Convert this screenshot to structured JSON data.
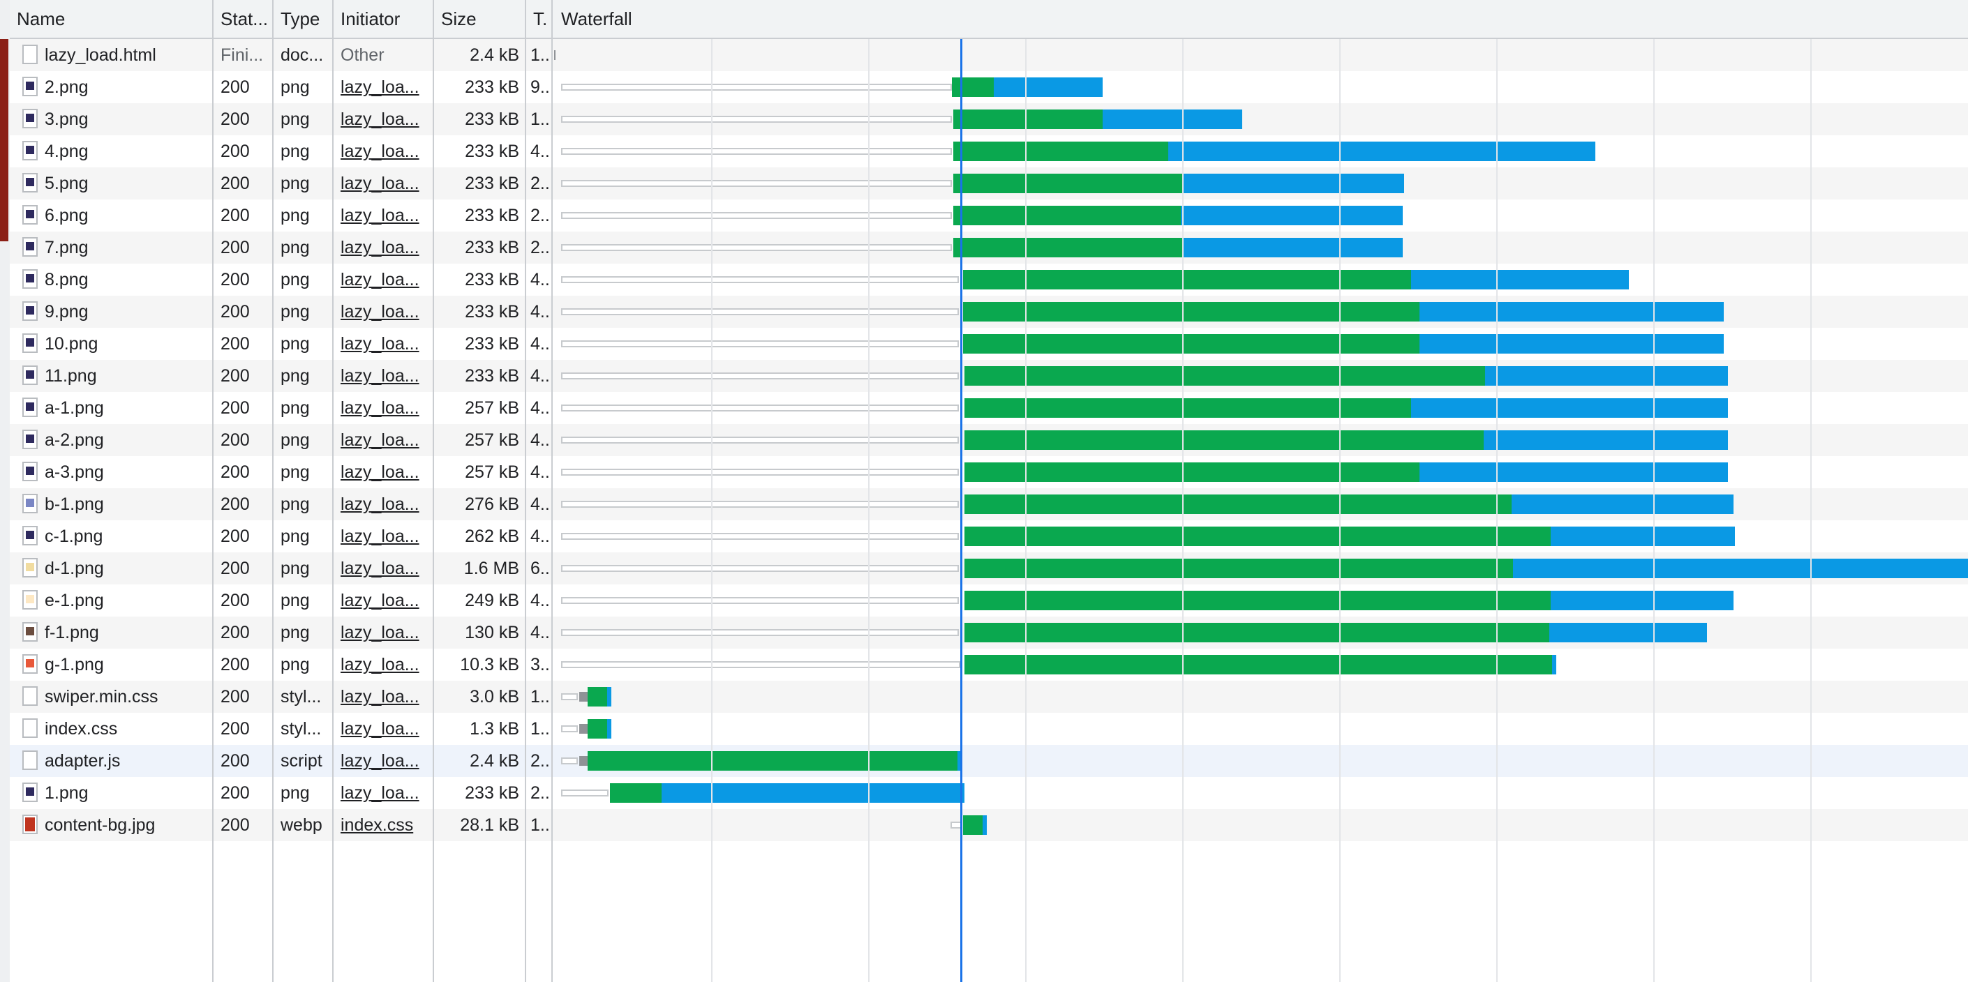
{
  "columns": {
    "name": "Name",
    "status": "Stat...",
    "type": "Type",
    "initiator": "Initiator",
    "size": "Size",
    "time": "T.",
    "waterfall": "Waterfall"
  },
  "colors": {
    "waiting_ttfb": "#0aa84f",
    "content_download": "#0a99e4",
    "dom_content_loaded_line": "#1a73e8",
    "header_bg": "#f1f3f4"
  },
  "rows": [
    {
      "name": "lazy_load.html",
      "status": "Fini...",
      "type": "doc...",
      "initiator": "Other",
      "size": "2.4 kB",
      "time": "1..",
      "icon": "document-icon"
    },
    {
      "name": "2.png",
      "status": "200",
      "type": "png",
      "initiator": "lazy_loa...",
      "size": "233 kB",
      "time": "9..",
      "icon": "image-icon"
    },
    {
      "name": "3.png",
      "status": "200",
      "type": "png",
      "initiator": "lazy_loa...",
      "size": "233 kB",
      "time": "1..",
      "icon": "image-icon"
    },
    {
      "name": "4.png",
      "status": "200",
      "type": "png",
      "initiator": "lazy_loa...",
      "size": "233 kB",
      "time": "4..",
      "icon": "image-icon"
    },
    {
      "name": "5.png",
      "status": "200",
      "type": "png",
      "initiator": "lazy_loa...",
      "size": "233 kB",
      "time": "2..",
      "icon": "image-icon"
    },
    {
      "name": "6.png",
      "status": "200",
      "type": "png",
      "initiator": "lazy_loa...",
      "size": "233 kB",
      "time": "2..",
      "icon": "image-icon"
    },
    {
      "name": "7.png",
      "status": "200",
      "type": "png",
      "initiator": "lazy_loa...",
      "size": "233 kB",
      "time": "2..",
      "icon": "image-icon"
    },
    {
      "name": "8.png",
      "status": "200",
      "type": "png",
      "initiator": "lazy_loa...",
      "size": "233 kB",
      "time": "4..",
      "icon": "image-icon"
    },
    {
      "name": "9.png",
      "status": "200",
      "type": "png",
      "initiator": "lazy_loa...",
      "size": "233 kB",
      "time": "4..",
      "icon": "image-icon"
    },
    {
      "name": "10.png",
      "status": "200",
      "type": "png",
      "initiator": "lazy_loa...",
      "size": "233 kB",
      "time": "4..",
      "icon": "image-icon"
    },
    {
      "name": "11.png",
      "status": "200",
      "type": "png",
      "initiator": "lazy_loa...",
      "size": "233 kB",
      "time": "4..",
      "icon": "image-icon"
    },
    {
      "name": "a-1.png",
      "status": "200",
      "type": "png",
      "initiator": "lazy_loa...",
      "size": "257 kB",
      "time": "4..",
      "icon": "image-icon"
    },
    {
      "name": "a-2.png",
      "status": "200",
      "type": "png",
      "initiator": "lazy_loa...",
      "size": "257 kB",
      "time": "4..",
      "icon": "image-icon"
    },
    {
      "name": "a-3.png",
      "status": "200",
      "type": "png",
      "initiator": "lazy_loa...",
      "size": "257 kB",
      "time": "4..",
      "icon": "image-icon"
    },
    {
      "name": "b-1.png",
      "status": "200",
      "type": "png",
      "initiator": "lazy_loa...",
      "size": "276 kB",
      "time": "4..",
      "icon": "image-icon"
    },
    {
      "name": "c-1.png",
      "status": "200",
      "type": "png",
      "initiator": "lazy_loa...",
      "size": "262 kB",
      "time": "4..",
      "icon": "image-icon"
    },
    {
      "name": "d-1.png",
      "status": "200",
      "type": "png",
      "initiator": "lazy_loa...",
      "size": "1.6 MB",
      "time": "6..",
      "icon": "image-icon"
    },
    {
      "name": "e-1.png",
      "status": "200",
      "type": "png",
      "initiator": "lazy_loa...",
      "size": "249 kB",
      "time": "4..",
      "icon": "image-icon"
    },
    {
      "name": "f-1.png",
      "status": "200",
      "type": "png",
      "initiator": "lazy_loa...",
      "size": "130 kB",
      "time": "4..",
      "icon": "image-icon"
    },
    {
      "name": "g-1.png",
      "status": "200",
      "type": "png",
      "initiator": "lazy_loa...",
      "size": "10.3 kB",
      "time": "3..",
      "icon": "image-icon"
    },
    {
      "name": "swiper.min.css",
      "status": "200",
      "type": "styl...",
      "initiator": "lazy_loa...",
      "size": "3.0 kB",
      "time": "1..",
      "icon": "document-icon"
    },
    {
      "name": "index.css",
      "status": "200",
      "type": "styl...",
      "initiator": "lazy_loa...",
      "size": "1.3 kB",
      "time": "1..",
      "icon": "document-icon"
    },
    {
      "name": "adapter.js",
      "status": "200",
      "type": "script",
      "initiator": "lazy_loa...",
      "size": "2.4 kB",
      "time": "2..",
      "icon": "document-icon"
    },
    {
      "name": "1.png",
      "status": "200",
      "type": "png",
      "initiator": "lazy_loa...",
      "size": "233 kB",
      "time": "2..",
      "icon": "image-icon"
    },
    {
      "name": "content-bg.jpg",
      "status": "200",
      "type": "webp",
      "initiator": "index.css",
      "size": "28.1 kB",
      "time": "1..",
      "icon": "image-icon"
    }
  ]
}
